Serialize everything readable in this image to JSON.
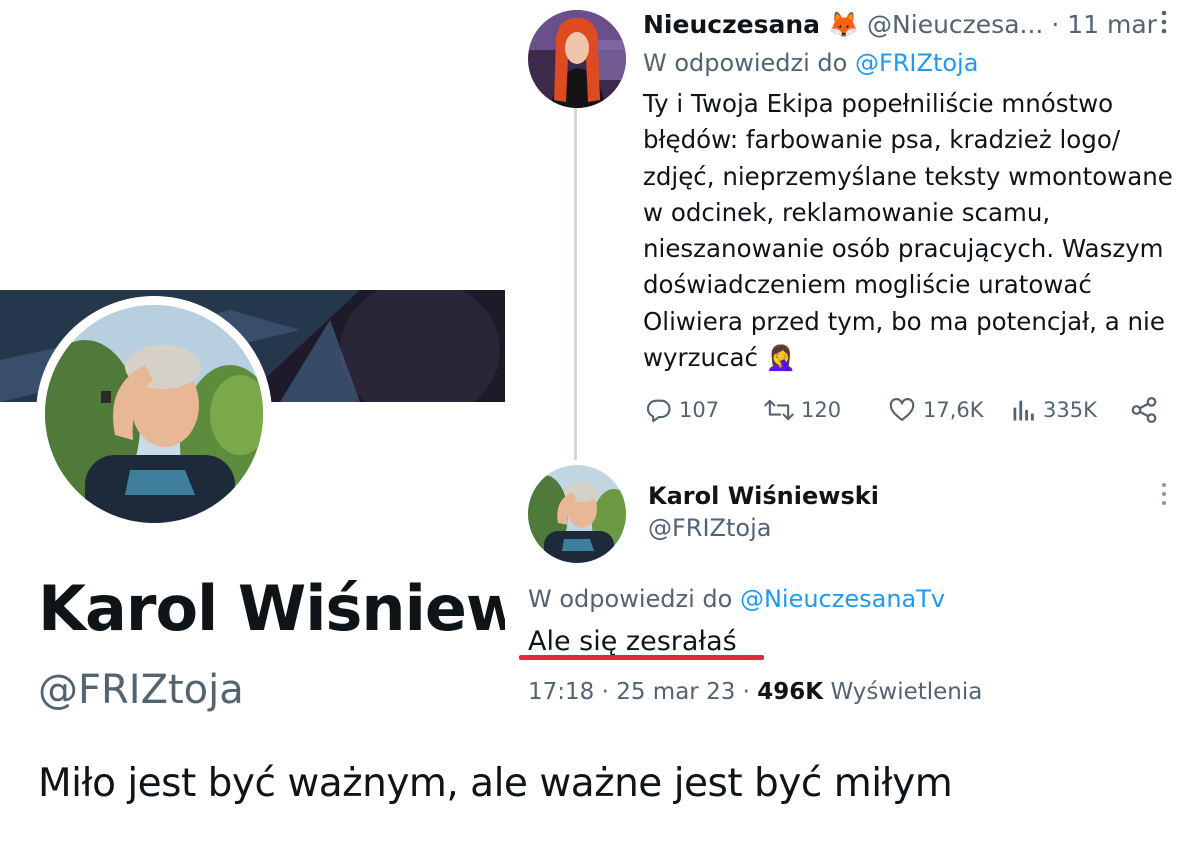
{
  "profile": {
    "name": "Karol Wiśniew",
    "handle": "@FRIZtoja",
    "bio": "Miło jest być ważnym, ale ważne jest być miłym"
  },
  "tweet_reply": {
    "author_name": "Nieuczesana",
    "author_emoji": "🦊",
    "author_handle": "@Nieuczesa...",
    "separator": "·",
    "date": "11 mar",
    "reply_prefix": "W odpowiedzi do",
    "reply_to": "@FRIZtoja",
    "body_lines": [
      "Ty i Twoja Ekipa popełniliście mnóstwo",
      "błędów: farbowanie psa, kradzież logo/",
      "zdjęć, nieprzemyślane teksty wmontowane",
      "w odcinek, reklamowanie scamu,",
      "nieszanowanie osób pracujących. Waszym",
      "doświadczeniem mogliście uratować",
      "Oliwiera przed tym, bo ma potencjał, a nie",
      "wyrzucać 🤦‍♀️"
    ],
    "stats": {
      "replies": "107",
      "retweets": "120",
      "likes": "17,6K",
      "views": "335K"
    }
  },
  "tweet_main": {
    "author_name": "Karol Wiśniewski",
    "author_handle": "@FRIZtoja",
    "reply_prefix": "W odpowiedzi do",
    "reply_to": "@NieuczesanaTv",
    "body": "Ale się zesrałaś",
    "time": "17:18",
    "separator": "·",
    "date": "25 mar 23",
    "views_count": "496K",
    "views_label": "Wyświetlenia"
  },
  "colors": {
    "text": "#0f1419",
    "secondary": "#536471",
    "link": "#1d9bf0",
    "underline": "#e0293b",
    "thread_line": "#cfd9de"
  },
  "icons": [
    "reply-icon",
    "retweet-icon",
    "like-icon",
    "views-icon",
    "share-icon",
    "more-icon"
  ]
}
